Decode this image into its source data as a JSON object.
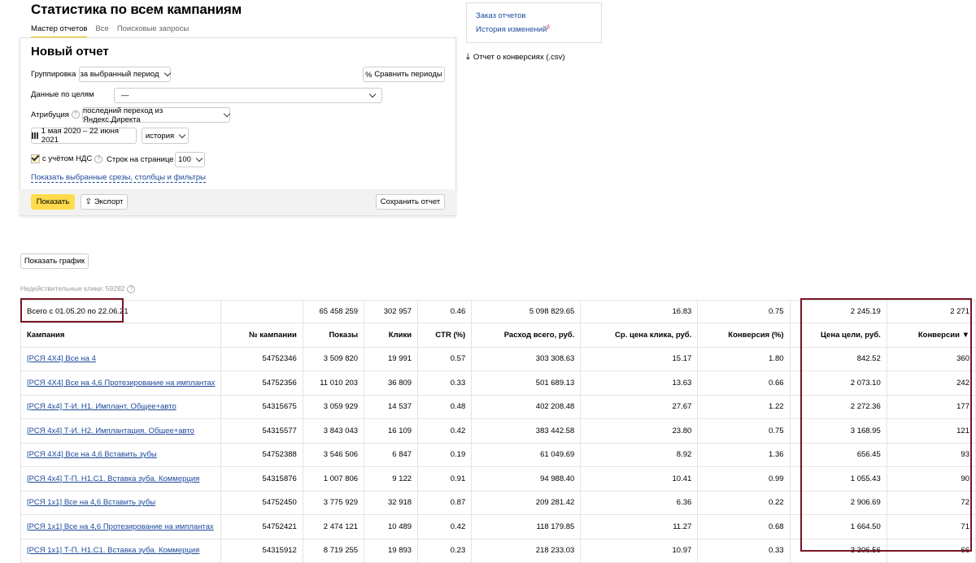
{
  "page": {
    "title": "Статистика по всем кампаниям",
    "tabs": [
      {
        "label": "Мастер отчетов",
        "active": true
      },
      {
        "label": "Все",
        "active": false
      },
      {
        "label": "Поисковые запросы",
        "active": false
      }
    ]
  },
  "report": {
    "heading": "Новый отчет",
    "grouping_label": "Группировка",
    "grouping_value": "за выбранный период",
    "compare_button": "Сравнить периоды",
    "goals_label": "Данные по целям",
    "goals_value": "—",
    "attribution_label": "Атрибуция",
    "attribution_value": "последний переход из Яндекс.Директа",
    "date_range": "1 мая 2020 – 22 июня 2021",
    "history_value": "история",
    "vat_label": "с учётом НДС",
    "vat_checked": true,
    "rows_label": "Строк на странице",
    "rows_value": "100",
    "show_filters_link": "Показать выбранные срезы, столбцы и фильтры",
    "show_button": "Показать",
    "export_button": "Экспорт",
    "save_button": "Сохранить отчет"
  },
  "side": {
    "order_reports": "Заказ отчетов",
    "history": "История изменений",
    "conversions_report": "Отчет о конверсиях (.csv)"
  },
  "show_chart_button": "Показать график",
  "invalid_clicks": "Недействительные клики: 59282",
  "table": {
    "total_row": [
      "Всего с 01.05.20 по 22.06.21",
      "",
      "65 458 259",
      "302 957",
      "0.46",
      "5 098 829.65",
      "16.83",
      "0.75",
      "2 245.19",
      "2 271"
    ],
    "headers": [
      "Кампания",
      "№ кампании",
      "Показы",
      "Клики",
      "CTR (%)",
      "Расход всего, руб.",
      "Ср. цена клика, руб.",
      "Конверсия (%)",
      "Цена цели, руб.",
      "Конверсии ▼"
    ],
    "rows": [
      [
        "[РСЯ 4Х4] Все на 4",
        "54752346",
        "3 509 820",
        "19 991",
        "0.57",
        "303 308.63",
        "15.17",
        "1.80",
        "842.52",
        "360"
      ],
      [
        "[РСЯ 4Х4] Все на 4,6 Протезирование на имплантах",
        "54752356",
        "11 010 203",
        "36 809",
        "0.33",
        "501 689.13",
        "13.63",
        "0.66",
        "2 073.10",
        "242"
      ],
      [
        "[РСЯ 4х4] Т-И. Н1. Имплант. Общее+авто",
        "54315675",
        "3 059 929",
        "14 537",
        "0.48",
        "402 208.48",
        "27.67",
        "1.22",
        "2 272.36",
        "177"
      ],
      [
        "[РСЯ 4х4] Т-И. Н2. Имплантация. Общее+авто",
        "54315577",
        "3 843 043",
        "16 109",
        "0.42",
        "383 442.58",
        "23.80",
        "0.75",
        "3 168.95",
        "121"
      ],
      [
        "[РСЯ 4Х4] Все на 4,6 Вставить зубы",
        "54752388",
        "3 546 506",
        "6 847",
        "0.19",
        "61 049.69",
        "8.92",
        "1.36",
        "656.45",
        "93"
      ],
      [
        "[РСЯ 4х4] Т-П. Н1.С1. Вставка зуба. Коммерция",
        "54315876",
        "1 007 806",
        "9 122",
        "0.91",
        "94 988.40",
        "10.41",
        "0.99",
        "1 055.43",
        "90"
      ],
      [
        "[РСЯ 1х1] Все на 4,6 Вставить зубы",
        "54752450",
        "3 775 929",
        "32 918",
        "0.87",
        "209 281.42",
        "6.36",
        "0.22",
        "2 906.69",
        "72"
      ],
      [
        "[РСЯ 1х1] Все на 4,6 Протезирование на имплантах",
        "54752421",
        "2 474 121",
        "10 489",
        "0.42",
        "118 179.85",
        "11.27",
        "0.68",
        "1 664.50",
        "71"
      ],
      [
        "[РСЯ 1х1] Т-П. Н1.С1. Вставка зуба. Коммерция",
        "54315912",
        "8 719 255",
        "19 893",
        "0.23",
        "218 233.03",
        "10.97",
        "0.33",
        "3 306.56",
        "66"
      ]
    ]
  },
  "colors": {
    "accent_yellow": "#ffdb4d",
    "highlight_red": "#7a1424",
    "link_blue": "#1b4a9c"
  }
}
